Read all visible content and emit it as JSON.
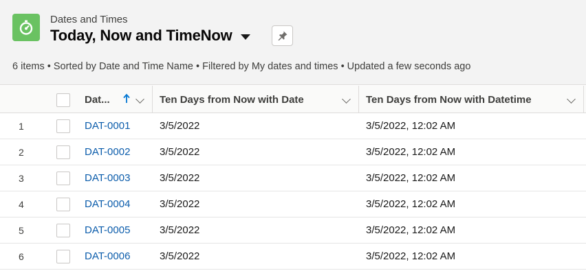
{
  "header": {
    "object_label": "Dates and Times",
    "title": "Today, Now and TimeNow",
    "summary": "6 items • Sorted by Date and Time Name • Filtered by My dates and times • Updated a few seconds ago",
    "icon": "stopwatch-icon",
    "icon_color": "#6ac262"
  },
  "table": {
    "columns": [
      {
        "label": "Dat...",
        "sorted": "ascending"
      },
      {
        "label": "Ten Days from Now with Date"
      },
      {
        "label": "Ten Days from Now with Datetime"
      }
    ],
    "rows": [
      {
        "num": "1",
        "name": "DAT-0001",
        "date": "3/5/2022",
        "datetime": "3/5/2022, 12:02 AM"
      },
      {
        "num": "2",
        "name": "DAT-0002",
        "date": "3/5/2022",
        "datetime": "3/5/2022, 12:02 AM"
      },
      {
        "num": "3",
        "name": "DAT-0003",
        "date": "3/5/2022",
        "datetime": "3/5/2022, 12:02 AM"
      },
      {
        "num": "4",
        "name": "DAT-0004",
        "date": "3/5/2022",
        "datetime": "3/5/2022, 12:02 AM"
      },
      {
        "num": "5",
        "name": "DAT-0005",
        "date": "3/5/2022",
        "datetime": "3/5/2022, 12:02 AM"
      },
      {
        "num": "6",
        "name": "DAT-0006",
        "date": "3/5/2022",
        "datetime": "3/5/2022, 12:02 AM"
      }
    ]
  },
  "colors": {
    "link": "#0b5cab",
    "header_bg": "#f3f3f3"
  }
}
